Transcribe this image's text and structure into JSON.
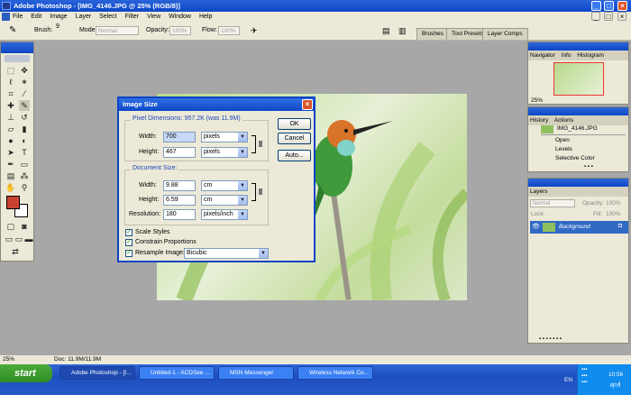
{
  "window": {
    "title": "Adobe Photoshop - [IMG_4146.JPG @ 25% (RGB/8)]"
  },
  "menu": [
    "File",
    "Edit",
    "Image",
    "Layer",
    "Select",
    "Filter",
    "View",
    "Window",
    "Help"
  ],
  "options": {
    "brush_label": "Brush:",
    "brush_size": "9",
    "mode_label": "Mode:",
    "mode_value": "Normal",
    "opacity_label": "Opacity:",
    "opacity_value": "100%",
    "flow_label": "Flow:",
    "flow_value": "100%",
    "tabs": [
      "Brushes",
      "Tool Presets",
      "Layer Comps"
    ]
  },
  "dialog": {
    "title": "Image Size",
    "pixel_dimensions_label": "Pixel Dimensions: 957.2K (was 11.9M)",
    "px_width_label": "Width:",
    "px_width_value": "700",
    "px_width_unit": "pixels",
    "px_height_label": "Height:",
    "px_height_value": "467",
    "px_height_unit": "pixels",
    "document_size_label": "Document Size:",
    "doc_width_label": "Width:",
    "doc_width_value": "9.88",
    "doc_width_unit": "cm",
    "doc_height_label": "Height:",
    "doc_height_value": "6.59",
    "doc_height_unit": "cm",
    "resolution_label": "Resolution:",
    "resolution_value": "180",
    "resolution_unit": "pixels/inch",
    "scale_styles": "Scale Styles",
    "constrain": "Constrain Proportions",
    "resample": "Resample Image:",
    "resample_method": "Bicubic",
    "ok": "OK",
    "cancel": "Cancel",
    "auto": "Auto..."
  },
  "navigator": {
    "tabs": [
      "Navigator",
      "Info",
      "Histogram"
    ],
    "zoom": "25%"
  },
  "history": {
    "tabs": [
      "History",
      "Actions"
    ],
    "snapshot": "IMG_4146.JPG",
    "items": [
      "Open",
      "Levels",
      "Selective Color"
    ]
  },
  "layers": {
    "tab": "Layers",
    "blend": "Normal",
    "opacity_label": "Opacity:",
    "opacity_value": "100%",
    "lock_label": "Lock:",
    "fill_label": "Fill:",
    "fill_value": "100%",
    "layer_name": "Background"
  },
  "status": {
    "zoom": "25%",
    "doc": "Doc: 11.9M/11.9M"
  },
  "taskbar": {
    "start": "start",
    "tasks": [
      "Adobe Photoshop - [I...",
      "Untitled-1 - ACDSee ...",
      "MSN Messenger",
      "Wireless Network Co..."
    ],
    "lang": "EN",
    "time": "10:56",
    "day": "ศุกร์"
  },
  "colors": {
    "foreground": "#c8432f",
    "title_blue": "#0c47c9",
    "layer_selected": "#316ac5"
  }
}
